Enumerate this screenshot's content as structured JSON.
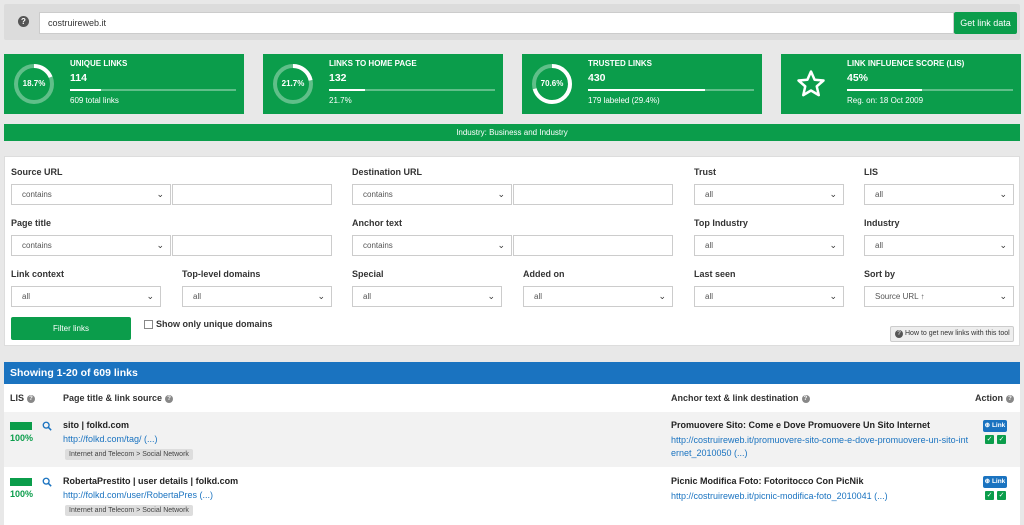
{
  "search": {
    "value": "costruireweb.it",
    "button_label": "Get link data"
  },
  "cards": [
    {
      "label": "UNIQUE LINKS",
      "value": "114",
      "sub": "609 total links",
      "ring_label": "18.7%",
      "ring_percent": 18.7,
      "bar_percent": 18.7
    },
    {
      "label": "LINKS TO HOME PAGE",
      "value": "132",
      "sub": "21.7%",
      "ring_label": "21.7%",
      "ring_percent": 21.7,
      "bar_percent": 21.7
    },
    {
      "label": "TRUSTED LINKS",
      "value": "430",
      "sub": "179 labeled (29.4%)",
      "ring_label": "70.6%",
      "ring_percent": 70.6,
      "bar_percent": 70.6
    },
    {
      "label": "LINK INFLUENCE SCORE (LIS)",
      "value": "45%",
      "sub": "Reg. on: 18 Oct 2009",
      "icon": "star-icon",
      "bar_percent": 45
    }
  ],
  "industry_bar": "Industry: Business and Industry",
  "filters": {
    "source_url": {
      "label": "Source URL",
      "mode": "contains"
    },
    "destination_url": {
      "label": "Destination URL",
      "mode": "contains"
    },
    "trust": {
      "label": "Trust",
      "value": "all"
    },
    "lis": {
      "label": "LIS",
      "value": "all"
    },
    "page_title": {
      "label": "Page title",
      "mode": "contains"
    },
    "anchor_text": {
      "label": "Anchor text",
      "mode": "contains"
    },
    "top_industry": {
      "label": "Top Industry",
      "value": "all"
    },
    "industry": {
      "label": "Industry",
      "value": "all"
    },
    "link_context": {
      "label": "Link context",
      "value": "all"
    },
    "top_level_domains": {
      "label": "Top-level domains",
      "value": "all"
    },
    "special": {
      "label": "Special",
      "value": "all"
    },
    "added_on": {
      "label": "Added on",
      "value": "all"
    },
    "last_seen": {
      "label": "Last seen",
      "value": "all"
    },
    "sort_by": {
      "label": "Sort by",
      "value": "Source URL ↑"
    },
    "filter_button": "Filter links",
    "unique_domains_label": "Show only unique domains",
    "howto_label": "How to get new links with this tool"
  },
  "results": {
    "header": "Showing 1-20 of 609 links",
    "columns": {
      "lis": "LIS",
      "page": "Page title & link source",
      "anchor": "Anchor text & link destination",
      "action": "Action"
    },
    "rows": [
      {
        "lis": "100%",
        "lis_percent": 100,
        "title": "sito | folkd.com",
        "source": "http://folkd.com/tag/ (...)",
        "tag": "Internet and Telecom > Social Network",
        "anchor": "Promuovere Sito: Come e Dove Promuovere Un Sito Internet",
        "dest": "http://costruireweb.it/promuovere-sito-come-e-dove-promuovere-un-sito-internet_2010050 (...)",
        "action": "Link"
      },
      {
        "lis": "100%",
        "lis_percent": 100,
        "title": "RobertaPrestito | user details | folkd.com",
        "source": "http://folkd.com/user/RobertaPres (...)",
        "tag": "Internet and Telecom > Social Network",
        "anchor": "Picnic Modifica Foto: Fotoritocco Con PicNik",
        "dest": "http://costruireweb.it/picnic-modifica-foto_2010041 (...)",
        "action": "Link"
      }
    ]
  },
  "colors": {
    "green": "#0b9d4b",
    "blue": "#1a73c0"
  }
}
